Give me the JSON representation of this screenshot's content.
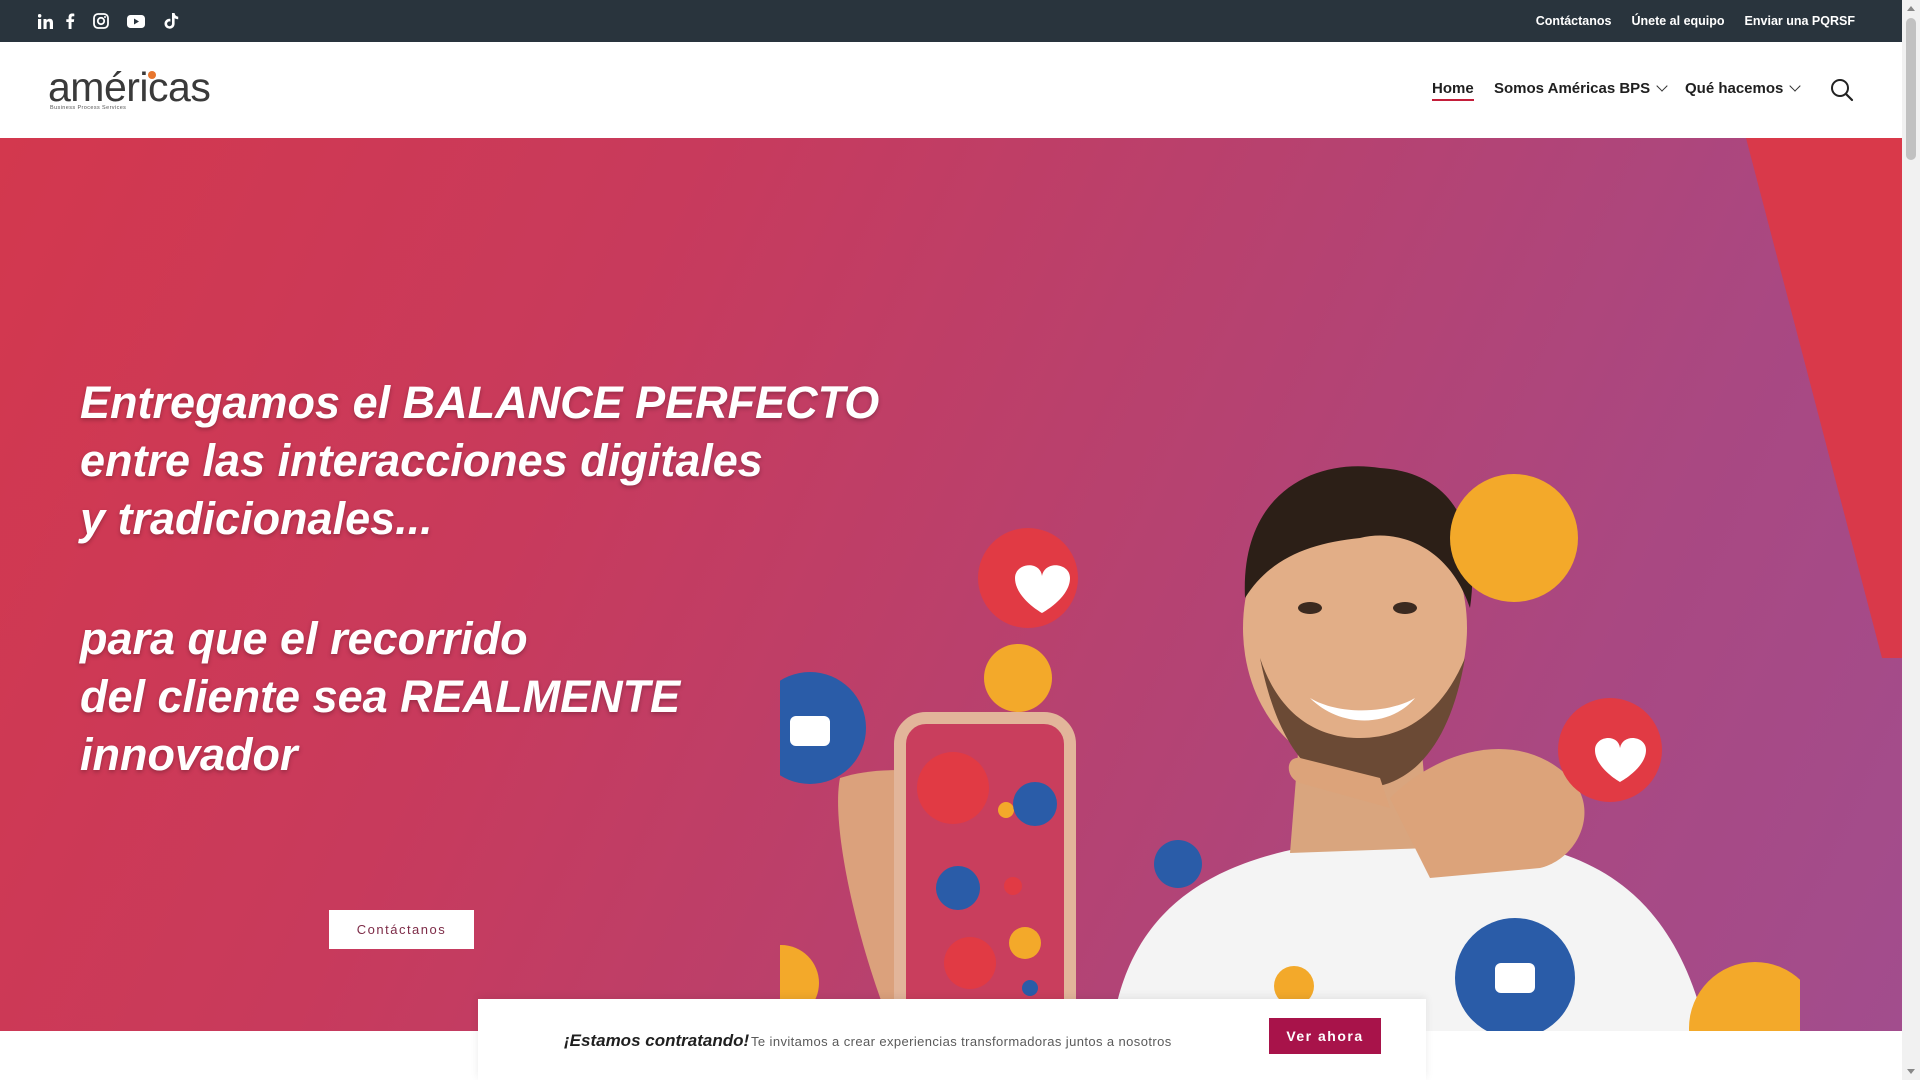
{
  "topbar": {
    "social_icons": [
      "linkedin-icon",
      "facebook-icon",
      "instagram-icon",
      "youtube-icon",
      "tiktok-icon"
    ],
    "links": [
      "Contáctanos",
      "Únete al equipo",
      "Enviar una PQRSF"
    ]
  },
  "header": {
    "logo_text": "américas",
    "logo_tagline": "Business Process Services",
    "nav": {
      "home": "Home",
      "somos": "Somos Américas BPS",
      "que_hacemos": "Qué hacemos"
    }
  },
  "hero": {
    "headline_lines": [
      "Entregamos el BALANCE PERFECTO",
      "entre las interacciones digitales",
      "y tradicionales...",
      "",
      "para que el recorrido",
      "del cliente sea REALMENTE",
      "innovador"
    ],
    "cta_label": "Contáctanos"
  },
  "hiring": {
    "title": "¡Estamos contratando!",
    "subtitle": "Te invitamos a crear experiencias transformadoras juntos a nosotros",
    "button_label": "Ver ahora"
  },
  "colors": {
    "topbar_bg": "#29343d",
    "hero_start": "#d3384e",
    "hero_end": "#a24d8d",
    "accent": "#a8134a",
    "active_underline": "#c41e3a"
  }
}
